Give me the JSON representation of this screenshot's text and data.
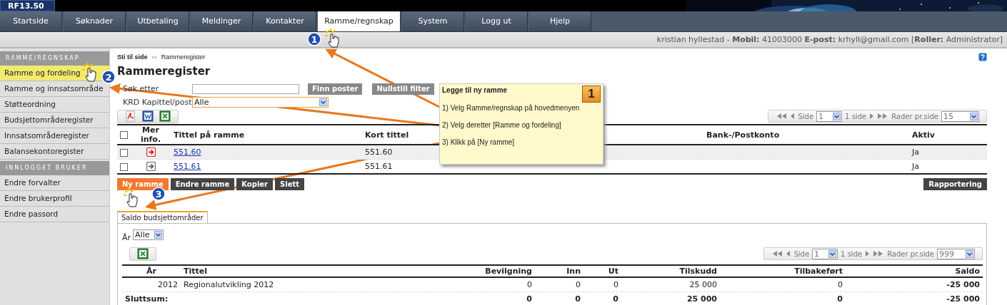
{
  "app": {
    "version": "RF13.50"
  },
  "nav_tabs": [
    {
      "label": "Startside",
      "selected": false
    },
    {
      "label": "Søknader",
      "selected": false
    },
    {
      "label": "Utbetaling",
      "selected": false
    },
    {
      "label": "Meldinger",
      "selected": false
    },
    {
      "label": "Kontakter",
      "selected": false
    },
    {
      "label": "Ramme/regnskap",
      "selected": true
    },
    {
      "label": "System",
      "selected": false
    },
    {
      "label": "Logg ut",
      "selected": false
    },
    {
      "label": "Hjelp",
      "selected": false
    }
  ],
  "user_bar": {
    "text": "kristian hyllestad - **Mobil:** 41003000 **E-post:** krhyll@gmail.com [**Roller:** Administrator]"
  },
  "sidebar": {
    "sections": [
      {
        "title": "RAMME/REGNSKAP",
        "items": [
          {
            "label": "Ramme og fordeling",
            "selected": true
          },
          {
            "label": "Ramme og innsatsområde",
            "selected": false
          },
          {
            "label": "Støtteordning",
            "selected": false
          },
          {
            "label": "Budsjettområderegister",
            "selected": false
          },
          {
            "label": "Innsatsområderegister",
            "selected": false
          },
          {
            "label": "Balansekontoregister",
            "selected": false
          }
        ]
      },
      {
        "title": "INNLOGGET BRUKER",
        "items": [
          {
            "label": "Endre forvalter",
            "selected": false
          },
          {
            "label": "Endre brukerprofil",
            "selected": false
          },
          {
            "label": "Endre passord",
            "selected": false
          }
        ]
      }
    ]
  },
  "breadcrumb": {
    "label": "Sti til side",
    "separator": "››",
    "current": "Rammeregister"
  },
  "page_title": "Rammeregister",
  "search": {
    "label": "Søk etter",
    "buttons": [
      "Finn poster",
      "Nullstill filter"
    ]
  },
  "chapter_filter": {
    "label": "KRD Kapittel/post",
    "value": "Alle"
  },
  "pager": {
    "side_label": "Side",
    "page": "1",
    "pages": "1 side",
    "rows_label": "Rader pr.side",
    "rows": "15"
  },
  "table": {
    "select_all": {
      "checked": false
    },
    "columns": [
      "Mer info.",
      "Tittel på ramme",
      "Kort tittel",
      "Bank-/Postkonto",
      "Aktiv"
    ],
    "rows": [
      {
        "checked": false,
        "info_highlighted": true,
        "title": "551.60",
        "short_title": "551.60",
        "active": "Ja"
      },
      {
        "checked": false,
        "info_highlighted": false,
        "title": "551.61",
        "short_title": "551.61",
        "active": "Ja"
      }
    ]
  },
  "actions": [
    {
      "label": "Ny ramme",
      "kind": "primary"
    },
    {
      "label": "Endre ramme",
      "kind": "normal"
    },
    {
      "label": "Kopier",
      "kind": "normal"
    },
    {
      "label": "Slett",
      "kind": "normal"
    }
  ],
  "report_button": "Rapportering",
  "panel": {
    "tabs": [
      {
        "label": "Saldo budsjettområder",
        "selected": true
      }
    ],
    "year_filter": {
      "label": "År",
      "value": "Alle"
    },
    "pager": {
      "side_label": "Side",
      "page": "1",
      "pages": "1 side",
      "rows_label": "Rader pr.side",
      "rows": "999"
    },
    "table": {
      "columns": [
        "År",
        "Tittel",
        "Bevilgning",
        "Inn",
        "Ut",
        "Tilskudd",
        "Tilbakeført",
        "Saldo"
      ],
      "rows": [
        {
          "kind": "data",
          "cells": [
            "2012",
            "Regionalutvikling 2012",
            "0",
            "0",
            "0",
            "25 000",
            "0",
            "-25 000"
          ]
        },
        {
          "kind": "total",
          "cells": [
            "Sluttsum:",
            "",
            "0",
            "0",
            "0",
            "25 000",
            "0",
            "-25 000"
          ]
        }
      ]
    }
  },
  "tutorial": {
    "title": "Legge til ny ramme",
    "badge": "1",
    "steps": [
      "1) Velg Ramme/regnskap på hovedmenyen",
      "2) Velg deretter [Ramme og fordeling]",
      "3) Klikk på [Ny ramme]"
    ]
  },
  "step_markers": [
    "1",
    "2",
    "3"
  ]
}
